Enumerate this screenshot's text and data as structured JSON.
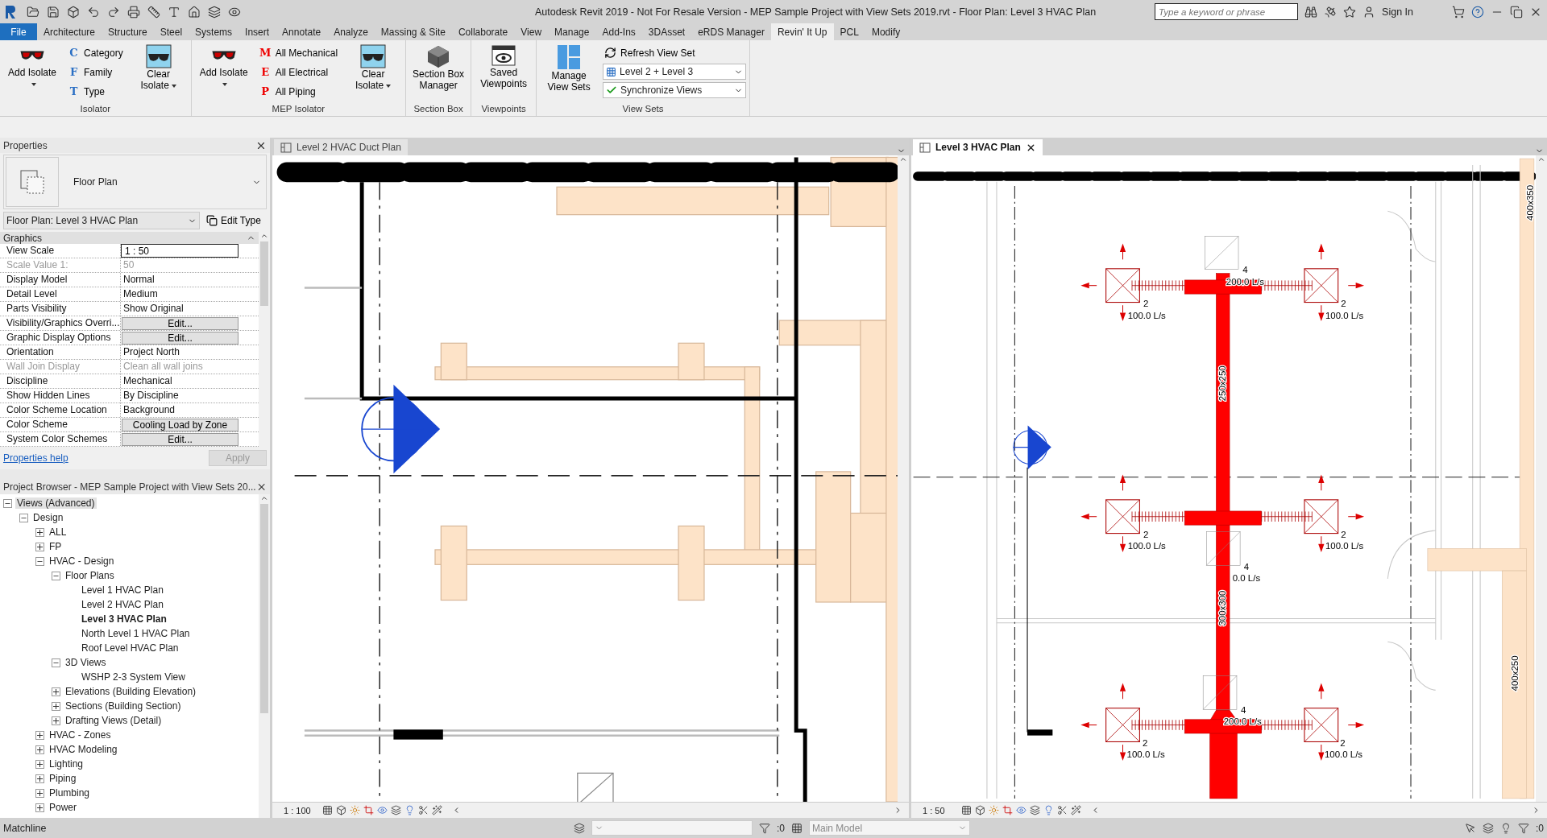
{
  "title_bar": {
    "title": "Autodesk Revit 2019 - Not For Resale Version - MEP Sample Project with View Sets 2019.rvt - Floor Plan: Level 3 HVAC Plan",
    "search": {
      "placeholder": "Type a keyword or phrase"
    },
    "sign_in": "Sign In"
  },
  "ribbon_tabs": [
    {
      "label": "File",
      "selected": false,
      "kind": "file"
    },
    {
      "label": "Architecture",
      "selected": false,
      "kind": "tab"
    },
    {
      "label": "Structure",
      "selected": false,
      "kind": "tab"
    },
    {
      "label": "Steel",
      "selected": false,
      "kind": "tab"
    },
    {
      "label": "Systems",
      "selected": false,
      "kind": "tab"
    },
    {
      "label": "Insert",
      "selected": false,
      "kind": "tab"
    },
    {
      "label": "Annotate",
      "selected": false,
      "kind": "tab"
    },
    {
      "label": "Analyze",
      "selected": false,
      "kind": "tab"
    },
    {
      "label": "Massing & Site",
      "selected": false,
      "kind": "tab"
    },
    {
      "label": "Collaborate",
      "selected": false,
      "kind": "tab"
    },
    {
      "label": "View",
      "selected": false,
      "kind": "tab"
    },
    {
      "label": "Manage",
      "selected": false,
      "kind": "tab"
    },
    {
      "label": "Add-Ins",
      "selected": false,
      "kind": "tab"
    },
    {
      "label": "3DAsset",
      "selected": false,
      "kind": "tab"
    },
    {
      "label": "eRDS Manager",
      "selected": false,
      "kind": "tab"
    },
    {
      "label": "Revin' It Up",
      "selected": true,
      "kind": "tab"
    },
    {
      "label": "PCL",
      "selected": false,
      "kind": "tab"
    },
    {
      "label": "Modify",
      "selected": false,
      "kind": "tab"
    }
  ],
  "ribbon_panels": [
    {
      "title": "Isolator",
      "tools": [
        {
          "kind": "large",
          "label": "Add Isolate",
          "dropdown": true
        },
        {
          "kind": "stack",
          "items": [
            {
              "glyph": "C",
              "label": "Category"
            },
            {
              "glyph": "F",
              "label": "Family"
            },
            {
              "glyph": "T",
              "label": "Type"
            }
          ]
        },
        {
          "kind": "large",
          "label": "Clear Isolate",
          "dropdown": true
        }
      ]
    },
    {
      "title": "MEP Isolator",
      "tools": [
        {
          "kind": "large",
          "label": "Add Isolate",
          "dropdown": true
        },
        {
          "kind": "stack",
          "items": [
            {
              "glyph": "M",
              "label": "All Mechanical"
            },
            {
              "glyph": "E",
              "label": "All Electrical"
            },
            {
              "glyph": "P",
              "label": "All Piping"
            }
          ]
        },
        {
          "kind": "large",
          "label": "Clear Isolate",
          "dropdown": true
        }
      ]
    },
    {
      "title": "Section Box",
      "tools": [
        {
          "kind": "large",
          "label": "Section Box Manager",
          "dropdown": false
        }
      ]
    },
    {
      "title": "Viewpoints",
      "tools": [
        {
          "kind": "large",
          "label": "Saved Viewpoints",
          "dropdown": false
        }
      ]
    },
    {
      "title": "View Sets",
      "tools": [
        {
          "kind": "large",
          "label": "Manage View Sets",
          "dropdown": false
        },
        {
          "kind": "viewsets",
          "refresh": "Refresh View Set",
          "view_set": "Level 2 + Level 3",
          "sync": "Synchronize Views"
        }
      ]
    }
  ],
  "properties": {
    "title": "Properties",
    "type_name": "Floor Plan",
    "instance": "Floor Plan: Level 3 HVAC Plan",
    "edit_type": "Edit Type",
    "group": "Graphics",
    "rows": [
      {
        "name": "View Scale",
        "value": "1 : 50",
        "kind": "input",
        "disabled": false
      },
      {
        "name": "Scale Value    1:",
        "value": "50",
        "kind": "text",
        "disabled": true
      },
      {
        "name": "Display Model",
        "value": "Normal",
        "kind": "text",
        "disabled": false
      },
      {
        "name": "Detail Level",
        "value": "Medium",
        "kind": "text",
        "disabled": false
      },
      {
        "name": "Parts Visibility",
        "value": "Show Original",
        "kind": "text",
        "disabled": false
      },
      {
        "name": "Visibility/Graphics Overri...",
        "value": "Edit...",
        "kind": "button",
        "disabled": false
      },
      {
        "name": "Graphic Display Options",
        "value": "Edit...",
        "kind": "button",
        "disabled": false
      },
      {
        "name": "Orientation",
        "value": "Project North",
        "kind": "text",
        "disabled": false
      },
      {
        "name": "Wall Join Display",
        "value": "Clean all wall joins",
        "kind": "text",
        "disabled": true
      },
      {
        "name": "Discipline",
        "value": "Mechanical",
        "kind": "text",
        "disabled": false
      },
      {
        "name": "Show Hidden Lines",
        "value": "By Discipline",
        "kind": "text",
        "disabled": false
      },
      {
        "name": "Color Scheme Location",
        "value": "Background",
        "kind": "text",
        "disabled": false
      },
      {
        "name": "Color Scheme",
        "value": "Cooling Load by Zone",
        "kind": "button",
        "disabled": false
      },
      {
        "name": "System Color Schemes",
        "value": "Edit...",
        "kind": "button",
        "disabled": false
      }
    ],
    "help": "Properties help",
    "apply": {
      "label": "Apply",
      "disabled": true
    }
  },
  "project_browser": {
    "title": "Project Browser - MEP Sample Project with View Sets 20...",
    "tree": [
      {
        "label": "Views (Advanced)",
        "selected": true,
        "active": false,
        "expanded": true,
        "children": [
          {
            "label": "Design",
            "selected": false,
            "active": false,
            "expanded": true,
            "children": [
              {
                "label": "ALL",
                "selected": false,
                "active": false,
                "expanded": false
              },
              {
                "label": "FP",
                "selected": false,
                "active": false,
                "expanded": false
              },
              {
                "label": "HVAC - Design",
                "selected": false,
                "active": false,
                "expanded": true,
                "children": [
                  {
                    "label": "Floor Plans",
                    "selected": false,
                    "active": false,
                    "expanded": true,
                    "children": [
                      {
                        "label": "Level 1 HVAC Plan",
                        "selected": false,
                        "active": false
                      },
                      {
                        "label": "Level 2 HVAC Plan",
                        "selected": false,
                        "active": false
                      },
                      {
                        "label": "Level 3 HVAC Plan",
                        "selected": false,
                        "active": true
                      },
                      {
                        "label": "North Level 1 HVAC Plan",
                        "selected": false,
                        "active": false
                      },
                      {
                        "label": "Roof Level HVAC Plan",
                        "selected": false,
                        "active": false
                      }
                    ]
                  },
                  {
                    "label": "3D Views",
                    "selected": false,
                    "active": false,
                    "expanded": true,
                    "children": [
                      {
                        "label": "WSHP 2-3 System View",
                        "selected": false,
                        "active": false
                      }
                    ]
                  },
                  {
                    "label": "Elevations (Building Elevation)",
                    "selected": false,
                    "active": false,
                    "expanded": false
                  },
                  {
                    "label": "Sections (Building Section)",
                    "selected": false,
                    "active": false,
                    "expanded": false
                  },
                  {
                    "label": "Drafting Views (Detail)",
                    "selected": false,
                    "active": false,
                    "expanded": false
                  }
                ]
              },
              {
                "label": "HVAC - Zones",
                "selected": false,
                "active": false,
                "expanded": false
              },
              {
                "label": "HVAC Modeling",
                "selected": false,
                "active": false,
                "expanded": false
              },
              {
                "label": "Lighting",
                "selected": false,
                "active": false,
                "expanded": false
              },
              {
                "label": "Piping",
                "selected": false,
                "active": false,
                "expanded": false
              },
              {
                "label": "Plumbing",
                "selected": false,
                "active": false,
                "expanded": false
              },
              {
                "label": "Power",
                "selected": false,
                "active": false,
                "expanded": false
              }
            ]
          }
        ]
      }
    ]
  },
  "views": [
    {
      "tab": "Level 2 HVAC Duct Plan",
      "selected": false,
      "kind": "duct_plan",
      "scale": "1 : 100"
    },
    {
      "tab": "Level 3 HVAC Plan",
      "selected": true,
      "kind": "hvac_plan",
      "scale": "1 : 50",
      "annotations": [
        "4",
        "200.0 L/s",
        "2",
        "100.0 L/s",
        "2",
        "100.0 L/s",
        "250x250",
        "2",
        "100.0 L/s",
        "2",
        "100.0 L/s",
        "4",
        "0.0 L/s",
        "300x300",
        "4",
        "200.0 L/s",
        "2",
        "100.0 L/s",
        "2",
        "100.0 L/s",
        "400x350",
        "400x250"
      ]
    }
  ],
  "status_bar": {
    "message": "Matchline",
    "count_a": ":0",
    "workset": "Main Model",
    "count_b": ":0"
  }
}
